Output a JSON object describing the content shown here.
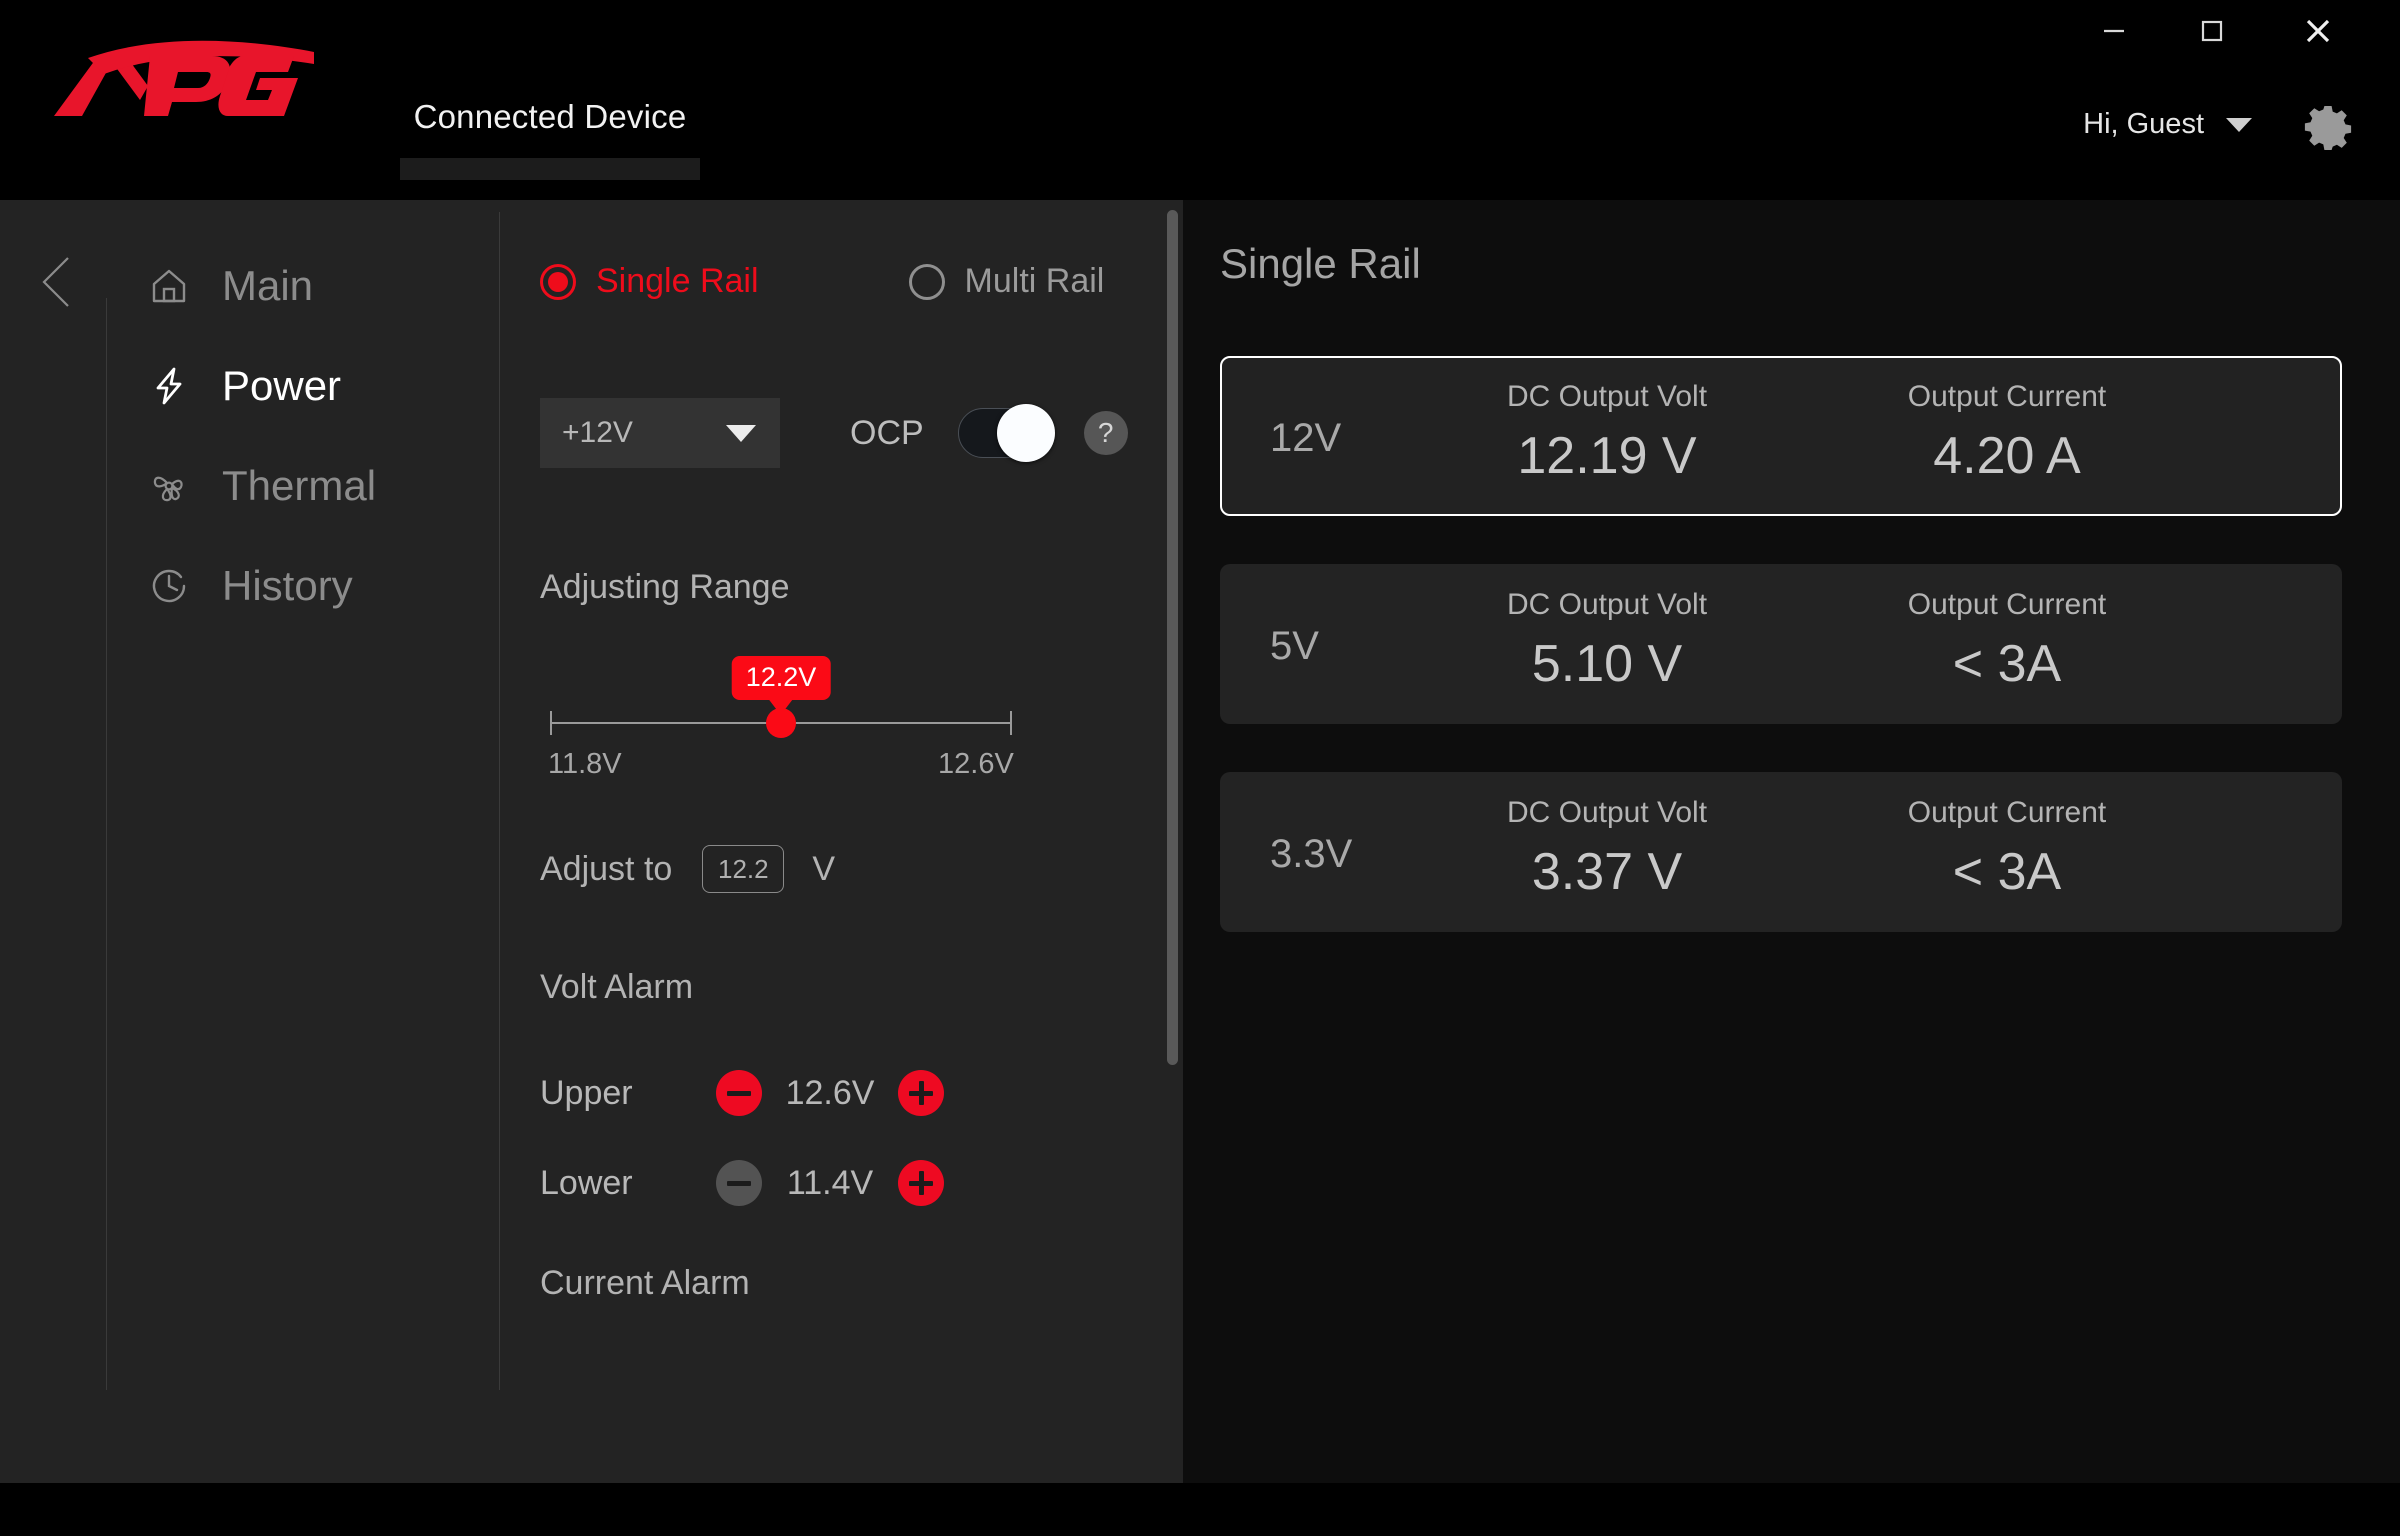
{
  "window": {
    "minimize_icon": "minimize-icon",
    "maximize_icon": "maximize-icon",
    "close_icon": "close-icon"
  },
  "header": {
    "logo_text": "XPG",
    "tab_label": "Connected Device",
    "account_label": "Hi, Guest",
    "account_caret_icon": "chevron-down-icon",
    "settings_icon": "gear-icon"
  },
  "sidebar": {
    "back_icon": "chevron-left-icon",
    "items": [
      {
        "label": "Main",
        "icon": "home-icon",
        "active": false
      },
      {
        "label": "Power",
        "icon": "lightning-icon",
        "active": true
      },
      {
        "label": "Thermal",
        "icon": "fan-icon",
        "active": false
      },
      {
        "label": "History",
        "icon": "clock-icon",
        "active": false
      }
    ]
  },
  "rail_mode": {
    "single_label": "Single Rail",
    "multi_label": "Multi Rail",
    "selected": "Single Rail"
  },
  "controls": {
    "rail_select_value": "+12V",
    "rail_select_options": [
      "+12V"
    ],
    "ocp_label": "OCP",
    "ocp_enabled": true,
    "help_icon": "question-icon",
    "help_label": "?"
  },
  "adjusting_range": {
    "title": "Adjusting Range",
    "min_label": "11.8V",
    "max_label": "12.6V",
    "min_value": 11.8,
    "max_value": 12.6,
    "current_value": 12.2,
    "tooltip_label": "12.2V",
    "adjust_to_label": "Adjust to",
    "adjust_to_value": "12.2",
    "adjust_to_unit": "V"
  },
  "volt_alarm": {
    "title": "Volt Alarm",
    "rows": [
      {
        "label": "Upper",
        "value": "12.6V",
        "minus_enabled": true,
        "plus_enabled": true
      },
      {
        "label": "Lower",
        "value": "11.4V",
        "minus_enabled": false,
        "plus_enabled": true
      }
    ]
  },
  "current_alarm": {
    "title": "Current Alarm"
  },
  "readout": {
    "title": "Single Rail",
    "col_volt_label": "DC Output Volt",
    "col_current_label": "Output Current",
    "cards": [
      {
        "rail": "12V",
        "volt": "12.19 V",
        "current": "4.20 A",
        "selected": true
      },
      {
        "rail": "5V",
        "volt": "5.10 V",
        "current": "< 3A",
        "selected": false
      },
      {
        "rail": "3.3V",
        "volt": "3.37 V",
        "current": "< 3A",
        "selected": false
      }
    ]
  },
  "colors": {
    "accent_red": "#ef0c1b",
    "bg_black": "#000000",
    "panel_gray": "#232323",
    "right_bg": "#0d0d0d"
  }
}
